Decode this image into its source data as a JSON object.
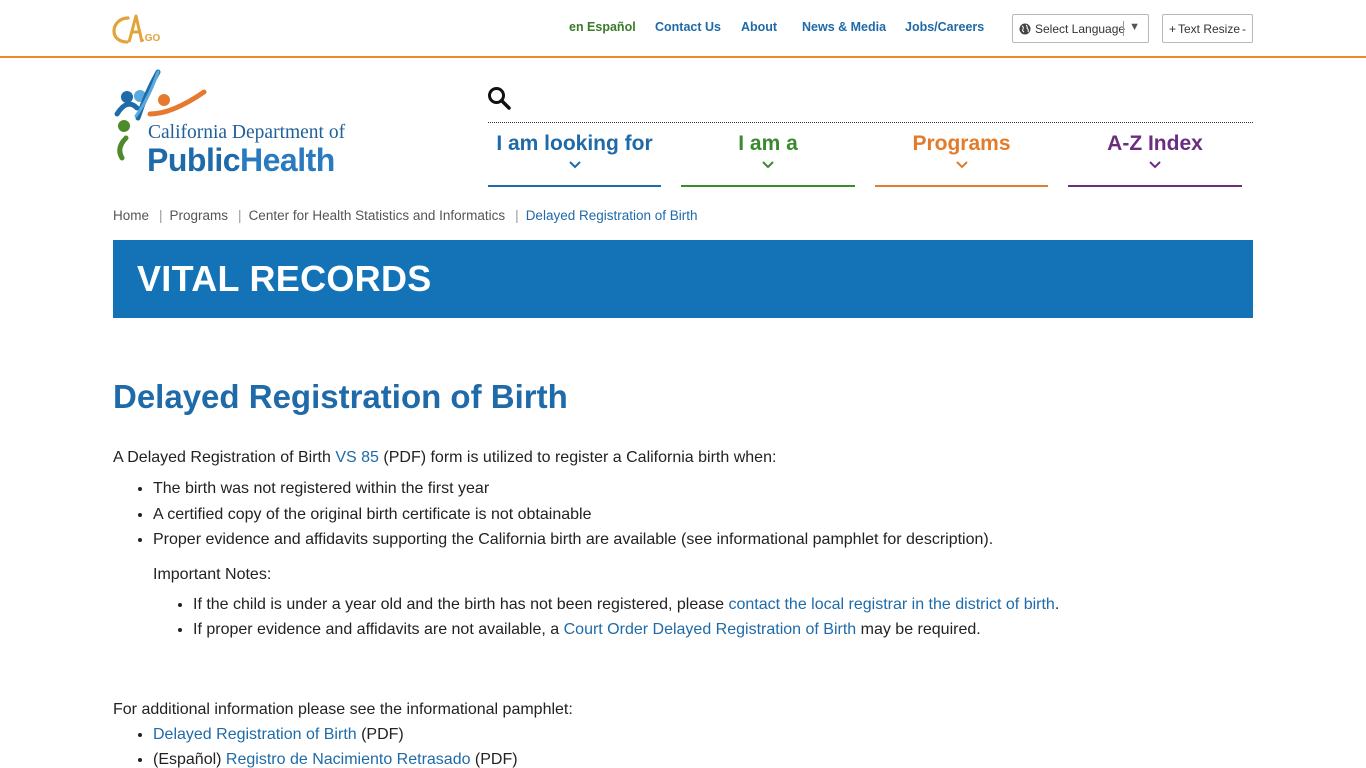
{
  "utility": {
    "espanol": "en Español",
    "contact": "Contact Us",
    "about": "About",
    "news": "News & Media",
    "jobs": "Jobs/Careers",
    "language": "Select Language",
    "resize_plus": "+",
    "resize_label": "Text Resize",
    "resize_minus": "-"
  },
  "logo": {
    "line1": "California Department of",
    "line2_public": "Public",
    "line2_health": "Health"
  },
  "nav": {
    "item1": "I am looking for",
    "item2": "I am a",
    "item3": "Programs",
    "item4": "A-Z Index"
  },
  "breadcrumb": {
    "home": "Home",
    "programs": "Programs",
    "center": "Center for Health Statistics and Informatics",
    "current": "Delayed Registration of Birth"
  },
  "banner": {
    "title": "VITAL RECORDS"
  },
  "page": {
    "title": "Delayed Registration of Birth",
    "intro_pre": "A Delayed Registration of Birth ",
    "intro_link": "VS 85",
    "intro_post": " (PDF) form is utilized to register a California birth when:",
    "bullets": [
      "The birth was not registered within the first year",
      "A certified copy of the original birth certificate is not obtainable",
      "Proper evidence and affidavits supporting the California birth are available (see informational pamphlet for description)."
    ],
    "notes_title": "Important Notes:",
    "note1_pre": "If the child is under a year old and the birth has not been registered, please ",
    "note1_link": "contact the local registrar in the district of birth",
    "note1_post": ".",
    "note2_pre": "If proper evidence and affidavits are not available, a ",
    "note2_link": "Court Order Delayed Registration of Birth",
    "note2_post": " may be required.",
    "addl_text": "For additional information please see the informational pamphlet:",
    "pamphlet1_link": "Delayed Registration of Birth",
    "pamphlet1_post": " (PDF)",
    "pamphlet2_pre": "(Español) ",
    "pamphlet2_link": "Registro de Nacimiento Retrasado",
    "pamphlet2_post": " (PDF)"
  },
  "colors": {
    "accent_orange": "#e98a2c",
    "brand_blue": "#1473b7",
    "nav_green": "#3a8a2e",
    "nav_purple": "#6a2d7f"
  }
}
